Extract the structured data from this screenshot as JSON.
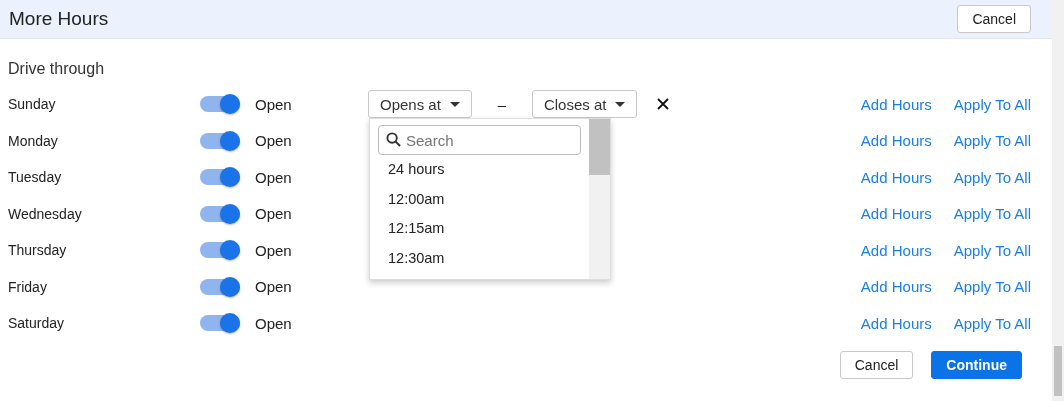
{
  "header": {
    "title": "More Hours",
    "cancel": "Cancel"
  },
  "section": "Drive through",
  "days": [
    {
      "name": "Sunday",
      "on": true,
      "status": "Open",
      "hours": {
        "opens": "Opens at",
        "separator": "–",
        "closes": "Closes at"
      },
      "add": "Add Hours",
      "apply": "Apply To All"
    },
    {
      "name": "Monday",
      "on": true,
      "status": "Open",
      "add": "Add Hours",
      "apply": "Apply To All"
    },
    {
      "name": "Tuesday",
      "on": true,
      "status": "Open",
      "add": "Add Hours",
      "apply": "Apply To All"
    },
    {
      "name": "Wednesday",
      "on": true,
      "status": "Open",
      "add": "Add Hours",
      "apply": "Apply To All"
    },
    {
      "name": "Thursday",
      "on": true,
      "status": "Open",
      "add": "Add Hours",
      "apply": "Apply To All"
    },
    {
      "name": "Friday",
      "on": true,
      "status": "Open",
      "add": "Add Hours",
      "apply": "Apply To All"
    },
    {
      "name": "Saturday",
      "on": true,
      "status": "Open",
      "add": "Add Hours",
      "apply": "Apply To All"
    }
  ],
  "dropdown": {
    "placeholder": "Search",
    "options": [
      "24 hours",
      "12:00am",
      "12:15am",
      "12:30am"
    ]
  },
  "footer": {
    "cancel": "Cancel",
    "continue": "Continue"
  }
}
